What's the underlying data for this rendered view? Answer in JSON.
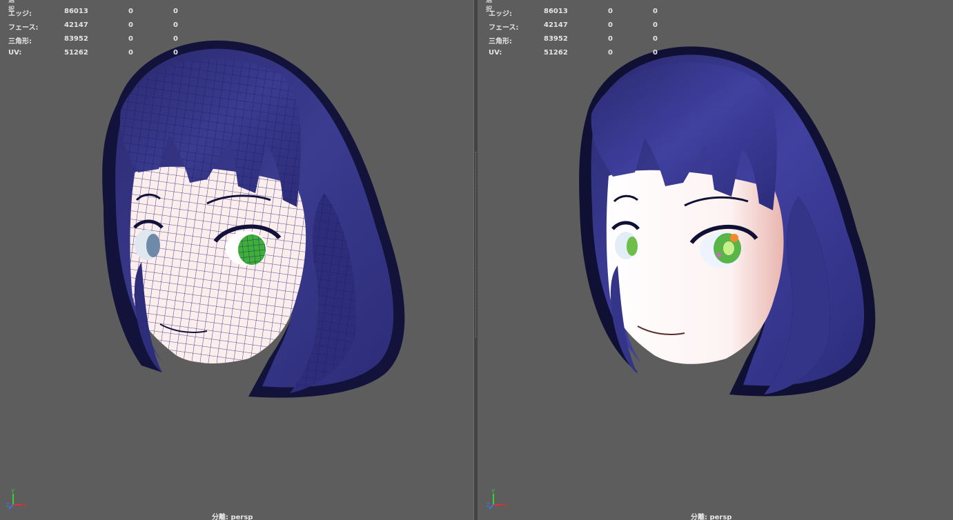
{
  "hud": {
    "cut_label": "選択",
    "rows": [
      {
        "label": "エッジ:",
        "value": "86013",
        "selected": "0",
        "triangles": "0"
      },
      {
        "label": "フェース:",
        "value": "42147",
        "selected": "0",
        "triangles": "0"
      },
      {
        "label": "三角形:",
        "value": "83952",
        "selected": "0",
        "triangles": "0"
      },
      {
        "label": "UV:",
        "value": "51262",
        "selected": "0",
        "triangles": "0"
      }
    ]
  },
  "camera": {
    "label": "分離: persp"
  },
  "axis": {
    "x": "X",
    "y": "Y",
    "z": "Z"
  },
  "colors": {
    "viewport_bg": "#5d5d5d",
    "hair": "#3a3a8c",
    "hair_shadow": "#12123a",
    "skin": "#fdeeee",
    "wireframe": "#1a1a6e",
    "eye_green": "#3fae3a",
    "axis_x": "#e03030",
    "axis_y": "#3ccf3c",
    "axis_z": "#3a7ae0"
  },
  "icons": {
    "axis_gizmo": "axis-gizmo-icon"
  }
}
